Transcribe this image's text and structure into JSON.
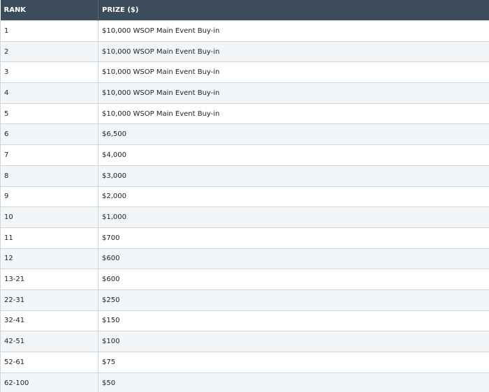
{
  "table": {
    "headers": [
      "RANK",
      "PRIZE ($)"
    ],
    "rows": [
      {
        "rank": "1",
        "prize": "$10,000 WSOP Main Event Buy-in"
      },
      {
        "rank": "2",
        "prize": "$10,000 WSOP Main Event Buy-in"
      },
      {
        "rank": "3",
        "prize": "$10,000 WSOP Main Event Buy-in"
      },
      {
        "rank": "4",
        "prize": "$10,000 WSOP Main Event Buy-in"
      },
      {
        "rank": "5",
        "prize": "$10,000 WSOP Main Event Buy-in"
      },
      {
        "rank": "6",
        "prize": "$6,500"
      },
      {
        "rank": "7",
        "prize": "$4,000"
      },
      {
        "rank": "8",
        "prize": "$3,000"
      },
      {
        "rank": "9",
        "prize": "$2,000"
      },
      {
        "rank": "10",
        "prize": "$1,000"
      },
      {
        "rank": "11",
        "prize": "$700"
      },
      {
        "rank": "12",
        "prize": "$600"
      },
      {
        "rank": "13-21",
        "prize": "$600"
      },
      {
        "rank": "22-31",
        "prize": "$250"
      },
      {
        "rank": "32-41",
        "prize": "$150"
      },
      {
        "rank": "42-51",
        "prize": "$100"
      },
      {
        "rank": "52-61",
        "prize": "$75"
      },
      {
        "rank": "62-100",
        "prize": "$50"
      }
    ]
  },
  "colors": {
    "header_bg": "#3c4c5a",
    "header_text": "#ffffff",
    "row_alt_bg": "#f2f6f9",
    "border": "#cfd6dc"
  }
}
